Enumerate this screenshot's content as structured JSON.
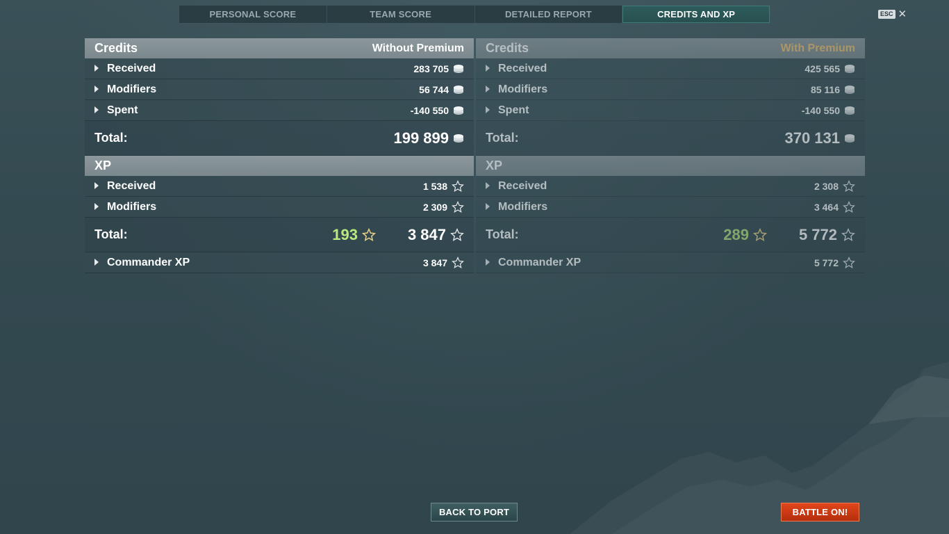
{
  "tabs": [
    {
      "label": "PERSONAL SCORE",
      "active": false
    },
    {
      "label": "TEAM SCORE",
      "active": false
    },
    {
      "label": "DETAILED REPORT",
      "active": false
    },
    {
      "label": "CREDITS AND XP",
      "active": true
    }
  ],
  "esc": {
    "label": "ESC"
  },
  "without_premium": {
    "credits": {
      "title": "Credits",
      "subtitle": "Without Premium",
      "received": {
        "label": "Received",
        "value": "283 705"
      },
      "modifiers": {
        "label": "Modifiers",
        "value": "56 744"
      },
      "spent": {
        "label": "Spent",
        "value": "-140 550"
      },
      "total": {
        "label": "Total:",
        "value": "199 899"
      }
    },
    "xp": {
      "title": "XP",
      "received": {
        "label": "Received",
        "value": "1 538"
      },
      "modifiers": {
        "label": "Modifiers",
        "value": "2 309"
      },
      "total": {
        "label": "Total:",
        "bonus": "193",
        "value": "3 847"
      },
      "commander": {
        "label": "Commander XP",
        "value": "3 847"
      }
    }
  },
  "with_premium": {
    "credits": {
      "title": "Credits",
      "subtitle": "With Premium",
      "received": {
        "label": "Received",
        "value": "425 565"
      },
      "modifiers": {
        "label": "Modifiers",
        "value": "85 116"
      },
      "spent": {
        "label": "Spent",
        "value": "-140 550"
      },
      "total": {
        "label": "Total:",
        "value": "370 131"
      }
    },
    "xp": {
      "title": "XP",
      "received": {
        "label": "Received",
        "value": "2 308"
      },
      "modifiers": {
        "label": "Modifiers",
        "value": "3 464"
      },
      "total": {
        "label": "Total:",
        "bonus": "289",
        "value": "5 772"
      },
      "commander": {
        "label": "Commander XP",
        "value": "5 772"
      }
    }
  },
  "buttons": {
    "back_to_port": "BACK TO PORT",
    "battle_on": "BATTLE ON!"
  },
  "colors": {
    "background": "#334a52",
    "active_tab": "#2f5c5c",
    "premium_label": "#f0c070",
    "bonus_xp": "#b8ea80",
    "battle_button": "#d23c14"
  }
}
